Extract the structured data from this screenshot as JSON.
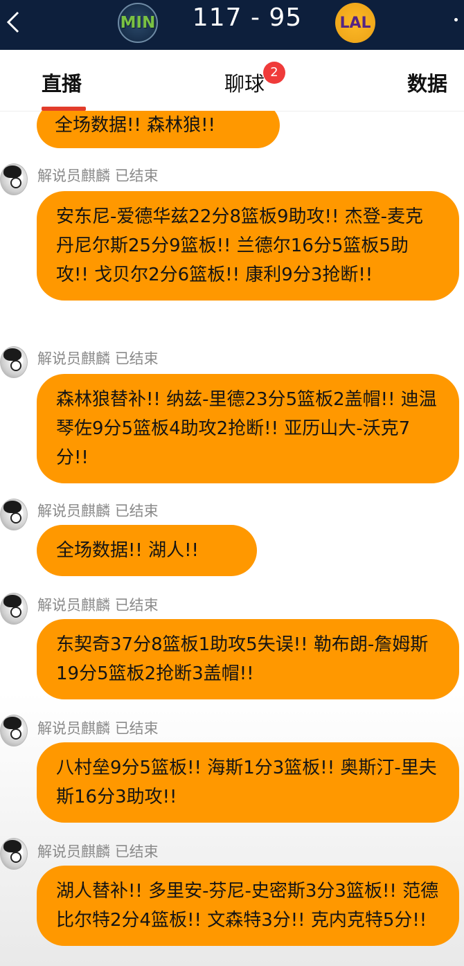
{
  "header": {
    "home_team": "MIN",
    "away_team": "LAL",
    "score": "117 - 95",
    "back_icon": "chevron-left-icon",
    "colors": {
      "bar": "#0d1f3c",
      "min_green": "#7ac143",
      "lal_purple": "#552583",
      "lal_gold": "#fdb927"
    }
  },
  "tabs": {
    "live": "直播",
    "chat": "聊球",
    "chat_badge": "2",
    "stats": "数据",
    "active_color": "#e23c2a"
  },
  "feed": {
    "bubble_color": "#ff9800",
    "top_partial": "全场数据!! 森林狼!!",
    "messages": [
      {
        "author": "解说员麒麟",
        "status": "已结束",
        "text": "安东尼-爱德华兹22分8篮板9助攻!! 杰登-麦克丹尼尔斯25分9篮板!! 兰德尔16分5篮板5助攻!! 戈贝尔2分6篮板!! 康利9分3抢断!!"
      },
      {
        "author": "解说员麒麟",
        "status": "已结束",
        "text": "森林狼替补!! 纳兹-里德23分5篮板2盖帽!! 迪温琴佐9分5篮板4助攻2抢断!! 亚历山大-沃克7分!!"
      },
      {
        "author": "解说员麒麟",
        "status": "已结束",
        "text": "全场数据!! 湖人!!"
      },
      {
        "author": "解说员麒麟",
        "status": "已结束",
        "text": "东契奇37分8篮板1助攻5失误!! 勒布朗-詹姆斯19分5篮板2抢断3盖帽!!"
      },
      {
        "author": "解说员麒麟",
        "status": "已结束",
        "text": "八村垒9分5篮板!! 海斯1分3篮板!! 奥斯汀-里夫斯16分3助攻!!"
      },
      {
        "author": "解说员麒麟",
        "status": "已结束",
        "text": "湖人替补!! 多里安-芬尼-史密斯3分3篮板!! 范德比尔特2分4篮板!! 文森特3分!! 克内克特5分!!"
      }
    ]
  }
}
